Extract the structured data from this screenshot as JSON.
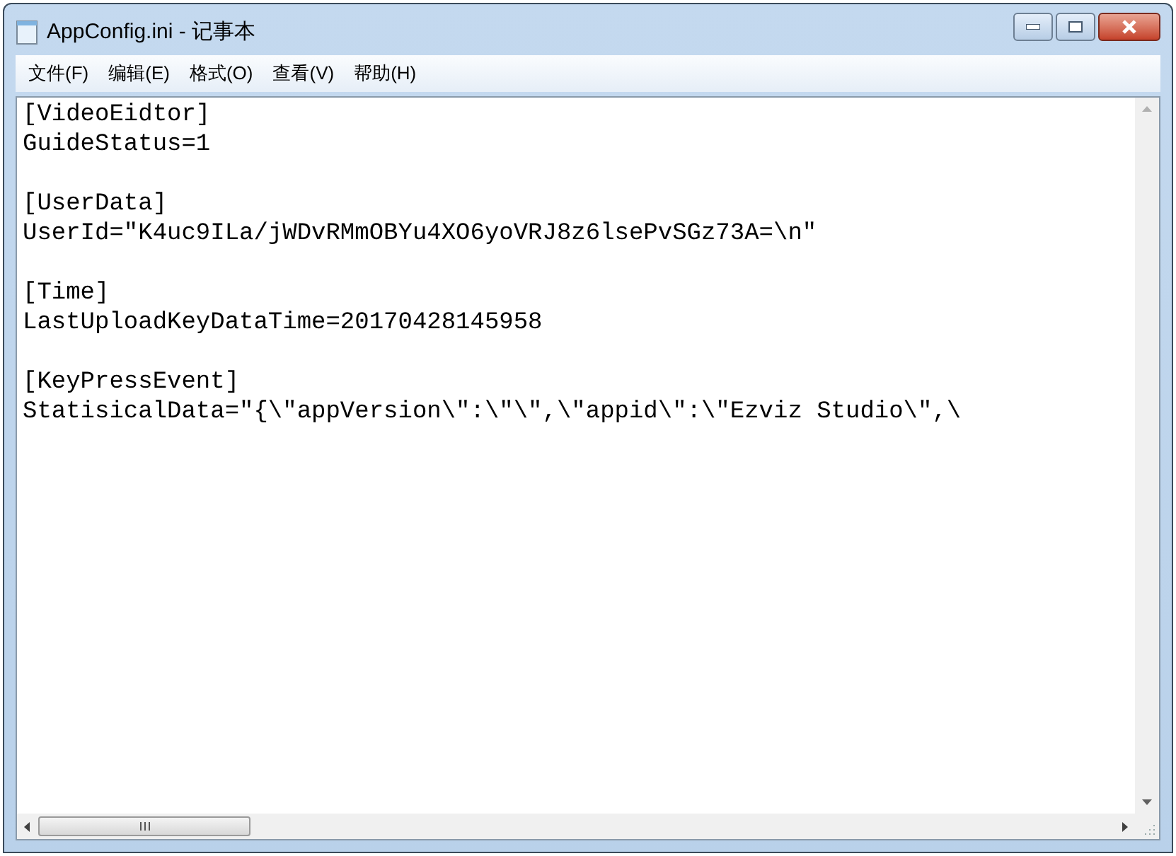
{
  "window": {
    "title": "AppConfig.ini - 记事本"
  },
  "menu": [
    "文件(F)",
    "编辑(E)",
    "格式(O)",
    "查看(V)",
    "帮助(H)"
  ],
  "sections": [
    {
      "header": "[VideoEidtor]",
      "entries": [
        "GuideStatus=1"
      ]
    },
    {
      "header": "[UserData]",
      "entries": [
        "UserId=\"K4uc9ILa/jWDvRMmOBYu4XO6yoVRJ8z6lsePvSGz73A=\\n\""
      ]
    },
    {
      "header": "[Time]",
      "entries": [
        "LastUploadKeyDataTime=20170428145958"
      ]
    },
    {
      "header": "[KeyPressEvent]",
      "entries": [
        "StatisicalData=\"{\\\"appVersion\\\":\\\"\\\",\\\"appid\\\":\\\"Ezviz Studio\\\",\\"
      ]
    }
  ]
}
